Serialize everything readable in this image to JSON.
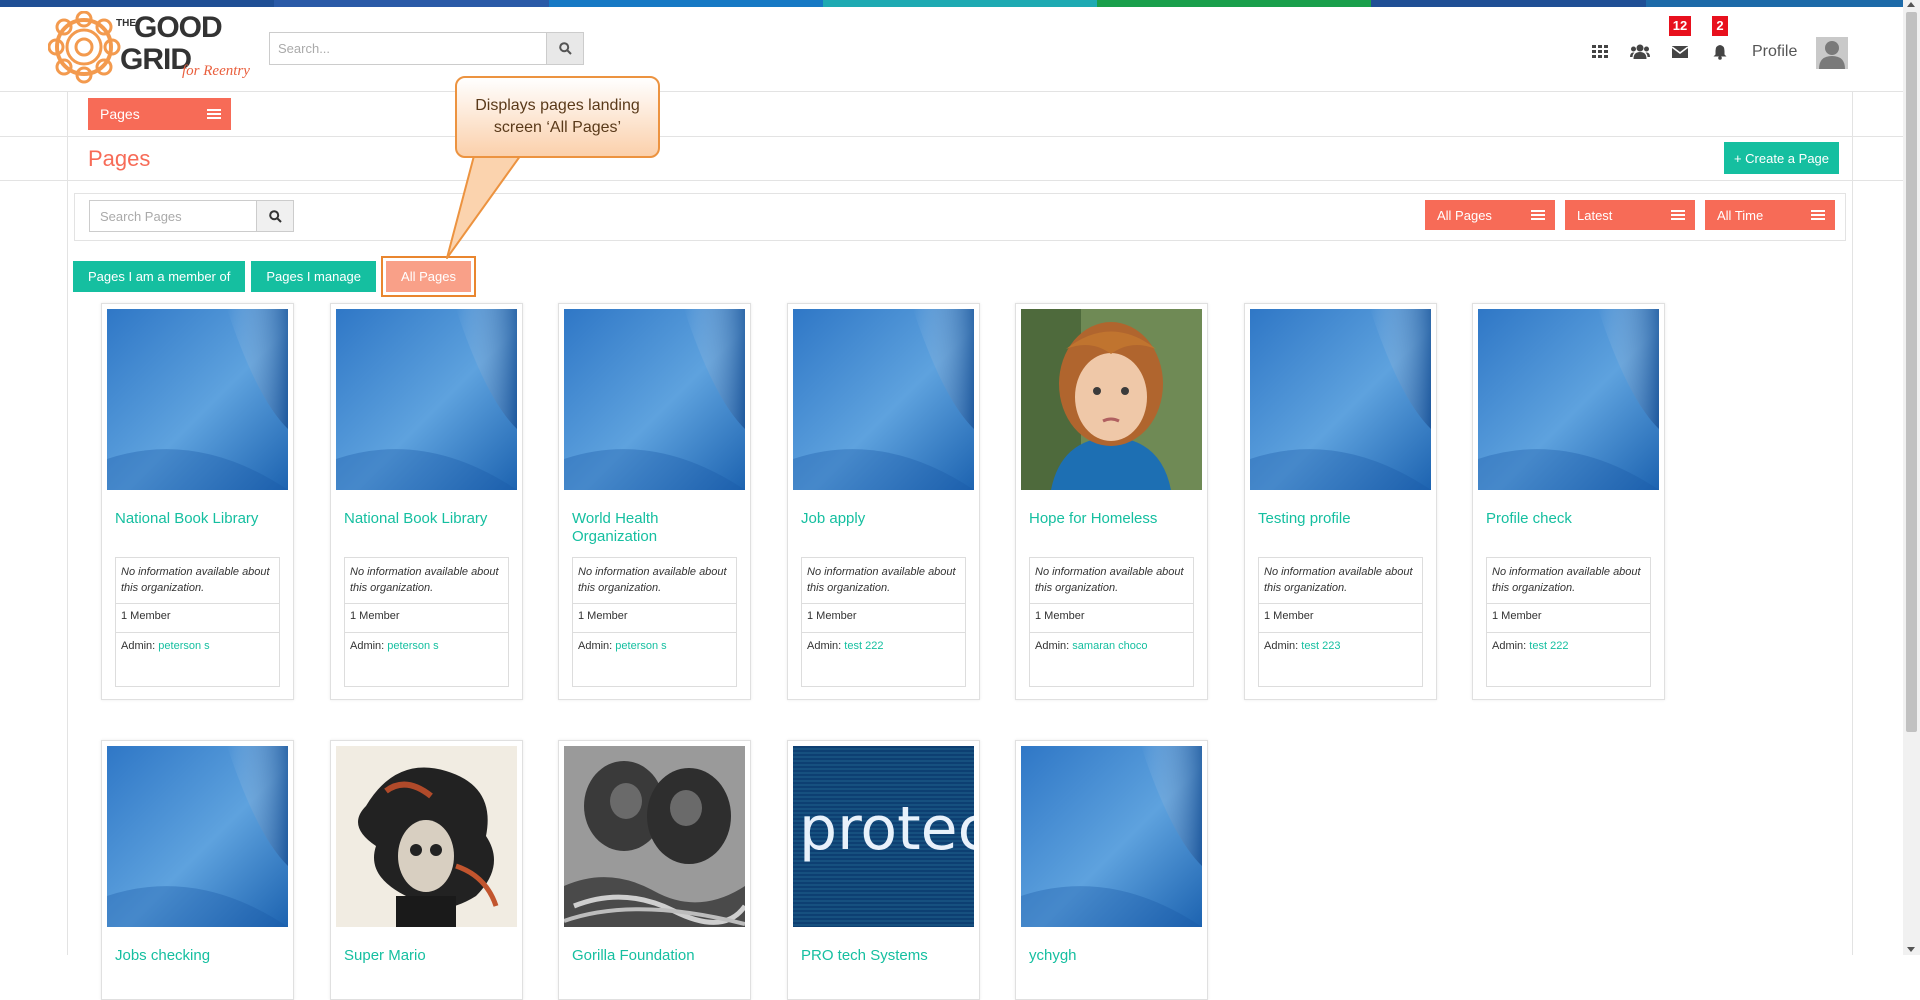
{
  "header": {
    "brand": {
      "the": "THE",
      "good": "GOOD",
      "grid": "GRID",
      "tagline": "for Reentry"
    },
    "search_placeholder": "Search...",
    "icons": [
      "grid-icon",
      "users-icon",
      "envelope-icon",
      "bell-icon"
    ],
    "messages_count": "12",
    "notifications_count": "2",
    "profile_label": "Profile",
    "stripe_colors": [
      "#2a5aa7",
      "#1679c4",
      "#1eaab2",
      "#1a9f4b",
      "#1f4f95",
      "#1d6aa8"
    ]
  },
  "toolbar": {
    "pages_dropdown_label": "Pages",
    "page_title": "Pages",
    "create_button_label": "+ Create a Page"
  },
  "filters": {
    "search_placeholder": "Search Pages",
    "scope_select": "All Pages",
    "sort_select": "Latest",
    "time_select": "All Time"
  },
  "tabs": [
    {
      "label": "Pages I am a member of",
      "active": false
    },
    {
      "label": "Pages I manage",
      "active": false
    },
    {
      "label": "All Pages",
      "active": true
    }
  ],
  "callout": {
    "text": "Displays pages landing screen ‘All Pages’"
  },
  "cards": [
    {
      "name": "National Book Library",
      "description": "No information available about this organization.",
      "members": "1 Member",
      "admin_label": "Admin:",
      "admin_name": "peterson s",
      "image": "blue-placeholder"
    },
    {
      "name": "National Book Library",
      "description": "No information available about this organization.",
      "members": "1 Member",
      "admin_label": "Admin:",
      "admin_name": "peterson s",
      "image": "blue-placeholder"
    },
    {
      "name": "World Health Organization",
      "description": "No information available about this organization.",
      "members": "1 Member",
      "admin_label": "Admin:",
      "admin_name": "peterson s",
      "image": "blue-placeholder"
    },
    {
      "name": "Job apply",
      "description": "No information available about this organization.",
      "members": "1 Member",
      "admin_label": "Admin:",
      "admin_name": "test 222",
      "image": "blue-placeholder"
    },
    {
      "name": "Hope for Homeless",
      "description": "No information available about this organization.",
      "members": "1 Member",
      "admin_label": "Admin:",
      "admin_name": "samaran choco",
      "image": "child-photo"
    },
    {
      "name": "Testing profile",
      "description": "No information available about this organization.",
      "members": "1 Member",
      "admin_label": "Admin:",
      "admin_name": "test 223",
      "image": "blue-placeholder"
    },
    {
      "name": "Profile check",
      "description": "No information available about this organization.",
      "members": "1 Member",
      "admin_label": "Admin:",
      "admin_name": "test 222",
      "image": "blue-placeholder"
    },
    {
      "name": "Jobs checking",
      "image": "blue-placeholder"
    },
    {
      "name": "Super Mario",
      "image": "ink-portrait"
    },
    {
      "name": "Gorilla Foundation",
      "image": "gorilla-photo"
    },
    {
      "name": "PRO tech Systems",
      "image": "protect-text",
      "image_text": "protec"
    },
    {
      "name": "ychygh",
      "image": "blue-placeholder"
    }
  ]
}
